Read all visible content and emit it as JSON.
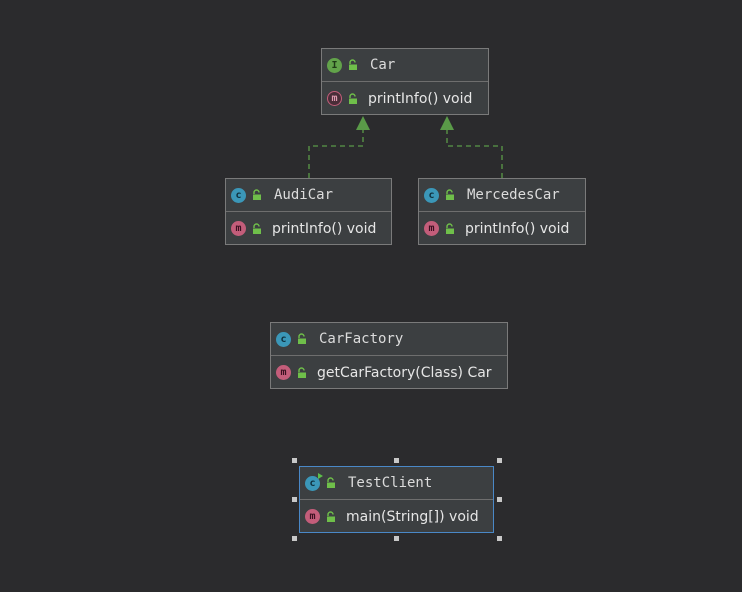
{
  "diagram": {
    "classes": [
      {
        "id": "car",
        "kind": "interface",
        "kind_badge": "I",
        "name": "Car",
        "member_badge": "m",
        "member": "printInfo()  void"
      },
      {
        "id": "audi",
        "kind": "class",
        "kind_badge": "c",
        "name": "AudiCar",
        "member_badge": "m",
        "member": "printInfo()  void"
      },
      {
        "id": "mercedes",
        "kind": "class",
        "kind_badge": "c",
        "name": "MercedesCar",
        "member_badge": "m",
        "member": "printInfo()  void"
      },
      {
        "id": "factory",
        "kind": "class",
        "kind_badge": "c",
        "name": "CarFactory",
        "member_badge": "m",
        "member": "getCarFactory(Class)  Car"
      },
      {
        "id": "client",
        "kind": "class",
        "kind_badge": "c",
        "name": "TestClient",
        "member_badge": "m",
        "member": "main(String[])  void"
      }
    ],
    "relations": [
      {
        "type": "realization",
        "from": "AudiCar",
        "to": "Car"
      },
      {
        "type": "realization",
        "from": "MercedesCar",
        "to": "Car"
      }
    ],
    "selected": "TestClient",
    "colors": {
      "background": "#2b2b2d",
      "box_fill": "#3c3f41",
      "box_border": "#7a7a7a",
      "selection_border": "#4a88c7",
      "realization_line": "#5a9a48",
      "interface_badge": "#62a34a",
      "class_badge": "#3b97b8",
      "method_badge": "#c35d7a",
      "lock_icon": "#6fbf4a"
    },
    "icons": [
      "interface-icon",
      "class-icon",
      "method-icon",
      "public-lock-icon",
      "runnable-marker-icon"
    ]
  }
}
